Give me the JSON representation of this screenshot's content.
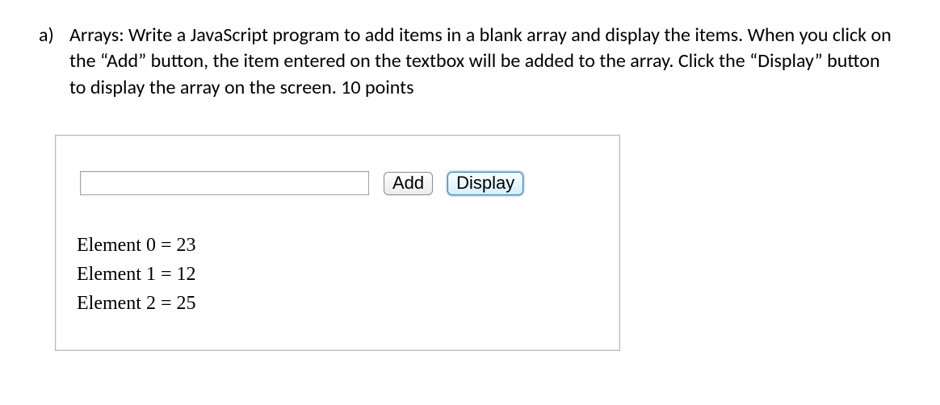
{
  "question": {
    "marker": "a)",
    "text": "Arrays: Write a JavaScript program to add items in a blank array and display the items. When you click on the “Add” button, the item entered on the textbox will be added to the array. Click the “Display” button to display the array on the screen. 10 points"
  },
  "form": {
    "input_value": "",
    "add_label": "Add",
    "display_label": "Display"
  },
  "output_lines": {
    "l0": "Element 0 = 23",
    "l1": "Element 1 = 12",
    "l2": "Element 2 = 25"
  }
}
